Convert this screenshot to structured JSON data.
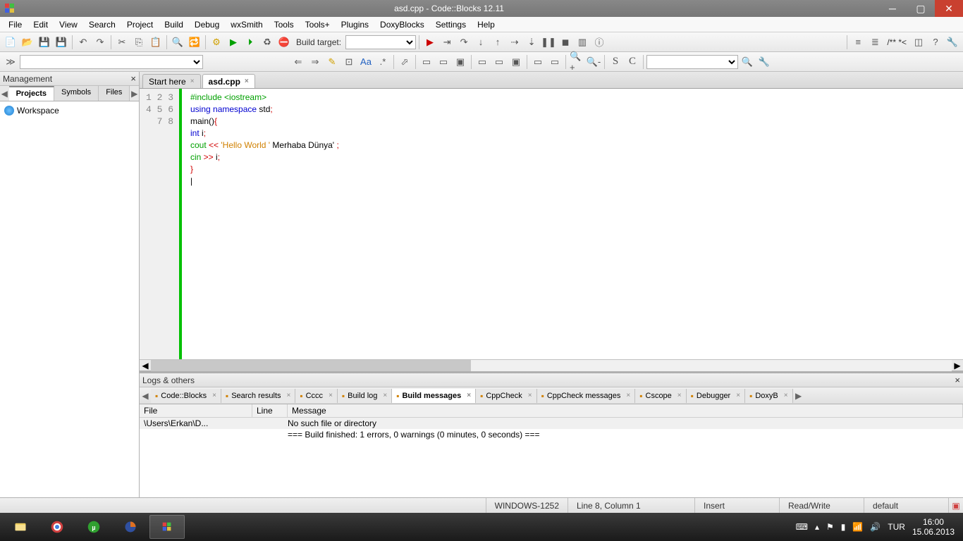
{
  "titlebar": {
    "title": "asd.cpp - Code::Blocks 12.11"
  },
  "menu": [
    "File",
    "Edit",
    "View",
    "Search",
    "Project",
    "Build",
    "Debug",
    "wxSmith",
    "Tools",
    "Tools+",
    "Plugins",
    "DoxyBlocks",
    "Settings",
    "Help"
  ],
  "toolbar": {
    "build_target_label": "Build target:"
  },
  "mgmt": {
    "title": "Management",
    "tabs": [
      "Projects",
      "Symbols",
      "Files"
    ],
    "workspace": "Workspace"
  },
  "editor_tabs": [
    {
      "label": "Start here",
      "active": false
    },
    {
      "label": "asd.cpp",
      "active": true
    }
  ],
  "code": {
    "line_count": 8,
    "lines": [
      [
        {
          "t": "#include ",
          "c": "pp"
        },
        {
          "t": "<iostream>",
          "c": "pp"
        }
      ],
      [
        {
          "t": "using ",
          "c": "kw-b"
        },
        {
          "t": "namespace ",
          "c": "kw-b"
        },
        {
          "t": "std",
          "c": ""
        },
        {
          "t": ";",
          "c": "op"
        }
      ],
      [
        {
          "t": "main",
          "c": ""
        },
        {
          "t": "()",
          "c": ""
        },
        {
          "t": "{",
          "c": "op"
        }
      ],
      [
        {
          "t": "int ",
          "c": "kw-b"
        },
        {
          "t": "i",
          "c": ""
        },
        {
          "t": ";",
          "c": "op"
        }
      ],
      [
        {
          "t": "cout",
          "c": "kw-g"
        },
        {
          "t": " << ",
          "c": "op"
        },
        {
          "t": "'Hello World '",
          "c": "str"
        },
        {
          "t": " Merhaba Dünya' ",
          "c": ""
        },
        {
          "t": ";",
          "c": "op"
        }
      ],
      [
        {
          "t": "cin",
          "c": "kw-g"
        },
        {
          "t": " >> ",
          "c": "op"
        },
        {
          "t": "i",
          "c": ""
        },
        {
          "t": ";",
          "c": "op"
        }
      ],
      [
        {
          "t": "}",
          "c": "op"
        }
      ],
      [
        {
          "t": "|",
          "c": ""
        }
      ]
    ]
  },
  "logs": {
    "title": "Logs & others",
    "tabs": [
      "Code::Blocks",
      "Search results",
      "Cccc",
      "Build log",
      "Build messages",
      "CppCheck",
      "CppCheck messages",
      "Cscope",
      "Debugger",
      "DoxyB"
    ],
    "active_tab": 4,
    "headers": {
      "file": "File",
      "line": "Line",
      "msg": "Message"
    },
    "rows": [
      {
        "file": "\\Users\\Erkan\\D...",
        "line": "",
        "msg": "No such file or directory",
        "hl": true
      },
      {
        "file": "",
        "line": "",
        "msg": "=== Build finished: 1 errors, 0 warnings (0 minutes, 0 seconds) ===",
        "hl": false
      }
    ]
  },
  "status": {
    "encoding": "WINDOWS-1252",
    "position": "Line 8, Column 1",
    "mode": "Insert",
    "rw": "Read/Write",
    "profile": "default"
  },
  "tray": {
    "lang": "TUR",
    "time": "16:00",
    "date": "15.06.2013"
  }
}
